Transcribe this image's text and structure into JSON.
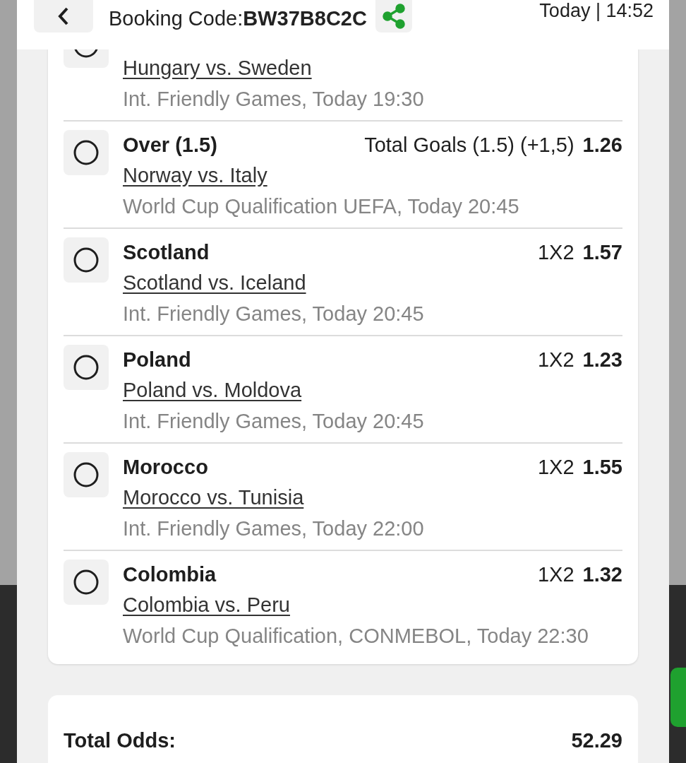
{
  "header": {
    "booking_label": "Booking Code:",
    "booking_code": "BW37B8C2C",
    "date_time": "Today | 14:52"
  },
  "selections": [
    {
      "kind": "cut",
      "selected": false,
      "match": "Hungary vs. Sweden",
      "league": "Int. Friendly Games, Today 19:30"
    },
    {
      "kind": "full",
      "selected": false,
      "pick": "Over (1.5)",
      "market": "Total Goals (1.5) (+1,5)",
      "odds": "1.26",
      "match": "Norway vs. Italy",
      "league": "World Cup Qualification UEFA, Today 20:45"
    },
    {
      "kind": "full",
      "selected": false,
      "pick": "Scotland",
      "market": "1X2",
      "odds": "1.57",
      "match": "Scotland vs. Iceland",
      "league": "Int. Friendly Games, Today 20:45"
    },
    {
      "kind": "full",
      "selected": false,
      "pick": "Poland",
      "market": "1X2",
      "odds": "1.23",
      "match": "Poland vs. Moldova",
      "league": "Int. Friendly Games, Today 20:45"
    },
    {
      "kind": "full",
      "selected": false,
      "pick": "Morocco",
      "market": "1X2",
      "odds": "1.55",
      "match": "Morocco vs. Tunisia",
      "league": "Int. Friendly Games, Today 22:00"
    },
    {
      "kind": "full",
      "selected": false,
      "pick": "Colombia",
      "market": "1X2",
      "odds": "1.32",
      "match": "Colombia vs. Peru",
      "league": "World Cup Qualification, CONMEBOL, Today 22:30"
    }
  ],
  "total": {
    "label": "Total Odds:",
    "value": "52.29"
  }
}
